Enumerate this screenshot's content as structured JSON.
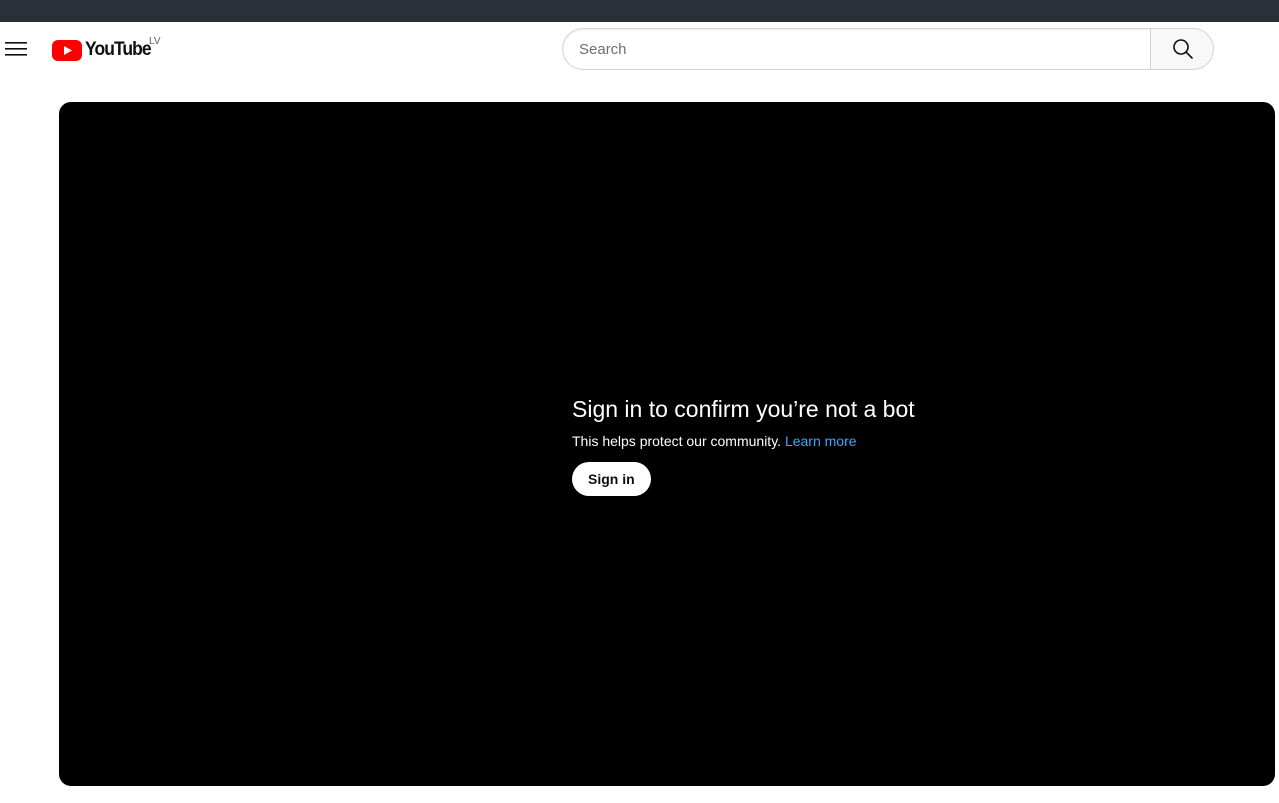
{
  "masthead": {
    "logo_alt": "YouTube",
    "logo_text": "YouTube",
    "country_code": "LV",
    "brand_red": "#ff0000",
    "icons": {
      "menu": "hamburger-menu-icon",
      "logo": "youtube-play-icon",
      "search": "search-icon"
    }
  },
  "search": {
    "placeholder": "Search",
    "value": ""
  },
  "player": {
    "background": "#000000",
    "title": "Sign in to confirm you’re not a bot",
    "description": "This helps protect our community.",
    "learn_more": "Learn more",
    "sign_in": "Sign in",
    "link_color": "#3ea6ff"
  }
}
